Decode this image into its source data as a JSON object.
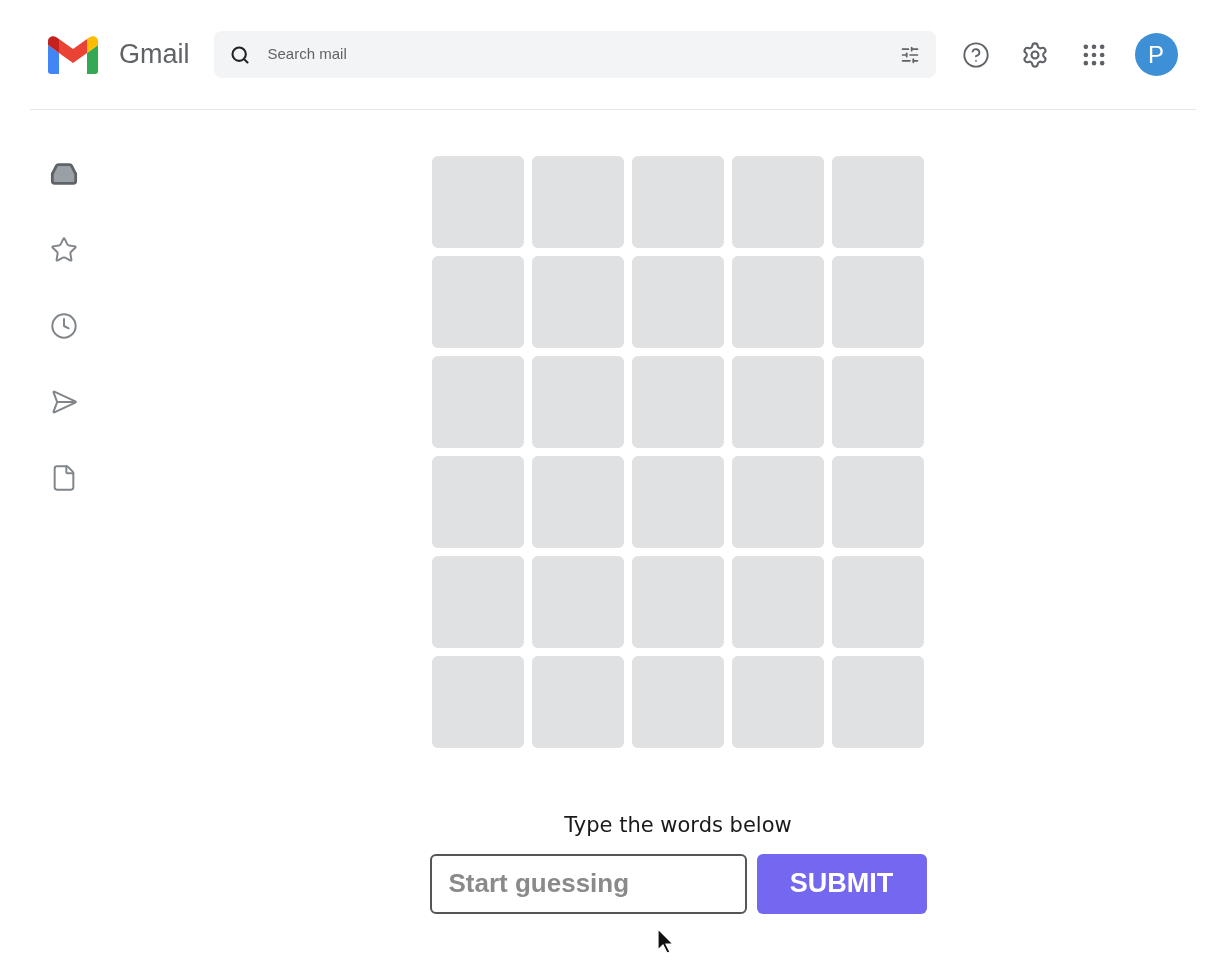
{
  "header": {
    "app_name": "Gmail",
    "search": {
      "placeholder": "Search mail"
    },
    "avatar": "P"
  },
  "sidebar": {
    "items": [
      {
        "kind": "inbox",
        "selected": true
      },
      {
        "kind": "starred",
        "selected": false
      },
      {
        "kind": "snoozed",
        "selected": false
      },
      {
        "kind": "sent",
        "selected": false
      },
      {
        "kind": "drafts",
        "selected": false
      }
    ]
  },
  "game": {
    "grid": [
      [
        {
          "kind": "empty"
        },
        {
          "kind": "empty"
        },
        {
          "kind": "empty"
        },
        {
          "kind": "empty"
        },
        {
          "kind": "empty"
        }
      ],
      [
        {
          "kind": "empty"
        },
        {
          "kind": "empty"
        },
        {
          "kind": "empty"
        },
        {
          "kind": "empty"
        },
        {
          "kind": "empty"
        }
      ],
      [
        {
          "kind": "empty"
        },
        {
          "kind": "empty"
        },
        {
          "kind": "empty"
        },
        {
          "kind": "empty"
        },
        {
          "kind": "empty"
        }
      ],
      [
        {
          "kind": "empty"
        },
        {
          "kind": "empty"
        },
        {
          "kind": "empty"
        },
        {
          "kind": "empty"
        },
        {
          "kind": "empty"
        }
      ],
      [
        {
          "kind": "empty"
        },
        {
          "kind": "empty"
        },
        {
          "kind": "empty"
        },
        {
          "kind": "empty"
        },
        {
          "kind": "empty"
        }
      ],
      [
        {
          "kind": "empty"
        },
        {
          "kind": "empty"
        },
        {
          "kind": "empty"
        },
        {
          "kind": "empty"
        },
        {
          "kind": "empty"
        }
      ]
    ],
    "prompt": "Type the words below",
    "input": {
      "placeholder": "Start guessing"
    },
    "submit": "SUBMIT"
  }
}
